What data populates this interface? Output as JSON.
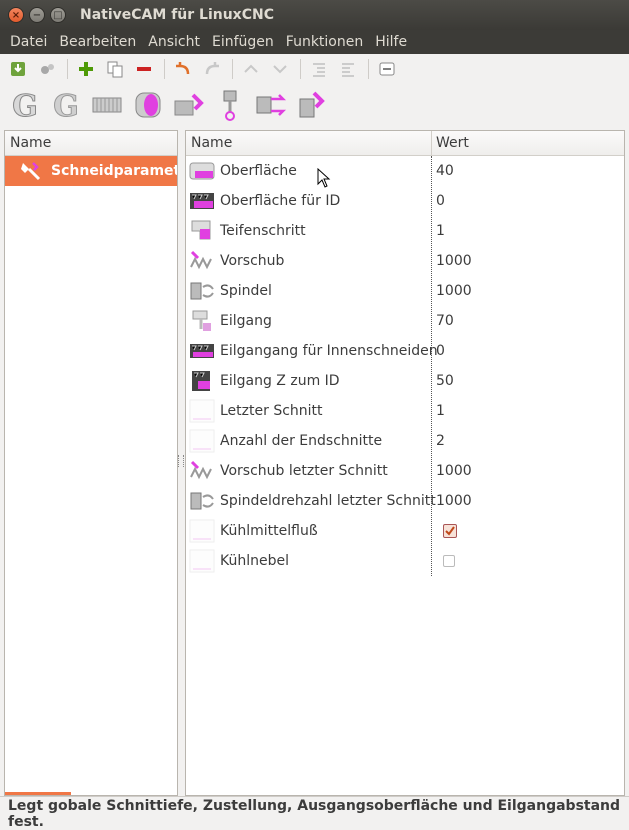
{
  "window": {
    "title": "NativeCAM für LinuxCNC"
  },
  "menu": [
    "Datei",
    "Bearbeiten",
    "Ansicht",
    "Einfügen",
    "Funktionen",
    "Hilfe"
  ],
  "left_tree": {
    "header": "Name",
    "item": "Schneidparamete"
  },
  "params": {
    "col_name": "Name",
    "col_value": "Wert",
    "rows": [
      {
        "name": "Oberfläche",
        "value": "40"
      },
      {
        "name": "Oberfläche für ID",
        "value": "0"
      },
      {
        "name": "Teifenschritt",
        "value": "1"
      },
      {
        "name": "Vorschub",
        "value": "1000"
      },
      {
        "name": "Spindel",
        "value": "1000"
      },
      {
        "name": "Eilgang",
        "value": "70"
      },
      {
        "name": "Eilgangang für Innenschneiden",
        "value": "0"
      },
      {
        "name": "Eilgang Z zum ID",
        "value": "50"
      },
      {
        "name": "Letzter Schnitt",
        "value": "1"
      },
      {
        "name": "Anzahl der Endschnitte",
        "value": "2"
      },
      {
        "name": "Vorschub letzter Schnitt",
        "value": "1000"
      },
      {
        "name": "Spindeldrehzahl letzter Schnitt",
        "value": "1000"
      },
      {
        "name": "Kühlmittelfluß",
        "checked": true
      },
      {
        "name": "Kühlnebel",
        "checked": false
      }
    ]
  },
  "status": "Legt gobale Schnittiefe, Zustellung, Ausgangsoberfläche und Eilgangabstand fest.",
  "colors": {
    "accent": "#f07746",
    "magenta": "#e040e0"
  }
}
